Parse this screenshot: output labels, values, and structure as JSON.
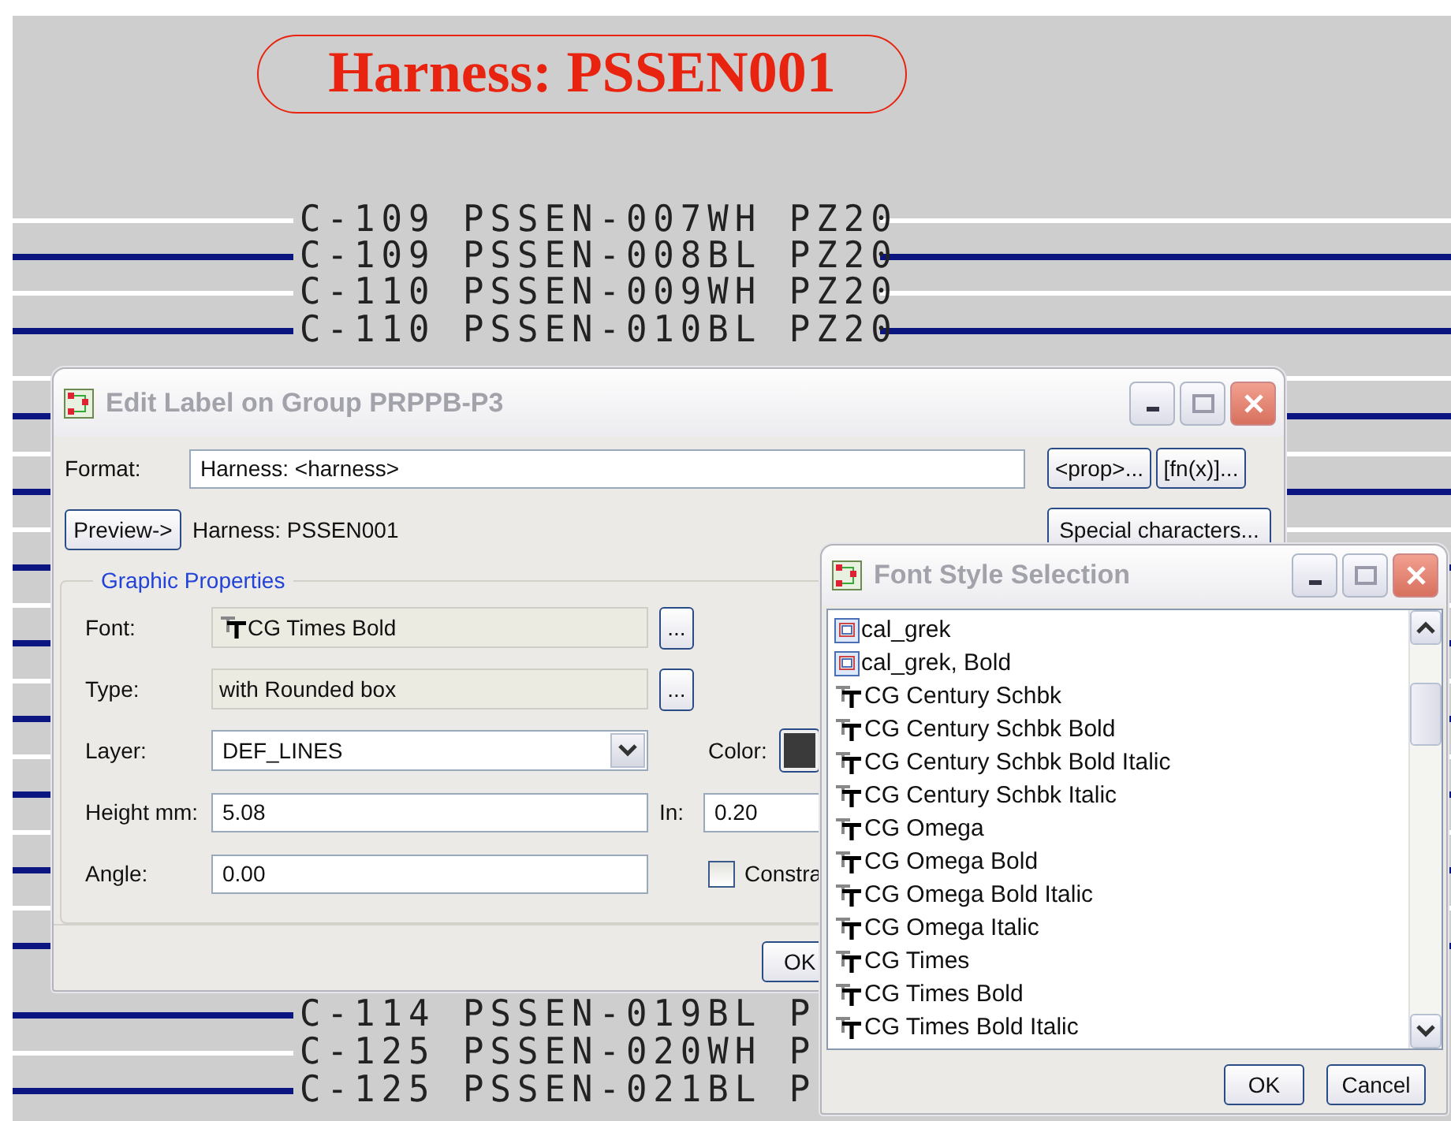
{
  "canvas": {
    "harness_label": "Harness: PSSEN001",
    "wires_top": [
      {
        "text": "C-109 PSSEN-007WH PZ20",
        "color": "#ffffff"
      },
      {
        "text": "C-109 PSSEN-008BL PZ20",
        "color": "#0a1580"
      },
      {
        "text": "C-110 PSSEN-009WH PZ20",
        "color": "#ffffff"
      },
      {
        "text": "C-110 PSSEN-010BL PZ20",
        "color": "#0a1580"
      }
    ],
    "wires_bottom": [
      {
        "text": "C-114 PSSEN-019BL P",
        "color": "#0a1580"
      },
      {
        "text": "C-125 PSSEN-020WH P",
        "color": "#ffffff"
      },
      {
        "text": "C-125 PSSEN-021BL P",
        "color": "#0a1580"
      }
    ]
  },
  "edit_dialog": {
    "title": "Edit Label on Group PRPPB-P3",
    "format": {
      "label": "Format:",
      "value": "Harness: <harness>"
    },
    "prop_button": "<prop>...",
    "fn_button": "[fn(x)]...",
    "preview_button": "Preview->",
    "preview_text": "Harness: PSSEN001",
    "special_button": "Special characters...",
    "group_title": "Graphic Properties",
    "font": {
      "label": "Font:",
      "value": "CG Times Bold",
      "button": "..."
    },
    "type": {
      "label": "Type:",
      "value": "with Rounded box",
      "button": "..."
    },
    "layer": {
      "label": "Layer:",
      "value": "DEF_LINES"
    },
    "color": {
      "label": "Color:",
      "color": "#3a3a3a"
    },
    "height": {
      "label": "Height mm:",
      "value": "5.08",
      "in_label": "In:",
      "in_value": "0.20"
    },
    "angle": {
      "label": "Angle:",
      "value": "0.00"
    },
    "constrain": {
      "label": "Constra",
      "checked": false
    },
    "ok_button": "OK"
  },
  "font_dialog": {
    "title": "Font Style Selection",
    "items": [
      {
        "label": "cal_grek",
        "kind": "vector"
      },
      {
        "label": "cal_grek, Bold",
        "kind": "vector"
      },
      {
        "label": "CG Century Schbk",
        "kind": "truetype"
      },
      {
        "label": "CG Century Schbk Bold",
        "kind": "truetype"
      },
      {
        "label": "CG Century Schbk Bold Italic",
        "kind": "truetype"
      },
      {
        "label": "CG Century Schbk Italic",
        "kind": "truetype"
      },
      {
        "label": "CG Omega",
        "kind": "truetype"
      },
      {
        "label": "CG Omega Bold",
        "kind": "truetype"
      },
      {
        "label": "CG Omega Bold Italic",
        "kind": "truetype"
      },
      {
        "label": "CG Omega Italic",
        "kind": "truetype"
      },
      {
        "label": "CG Times",
        "kind": "truetype"
      },
      {
        "label": "CG Times Bold",
        "kind": "truetype"
      },
      {
        "label": "CG Times Bold Italic",
        "kind": "truetype"
      }
    ],
    "ok_button": "OK",
    "cancel_button": "Cancel"
  }
}
